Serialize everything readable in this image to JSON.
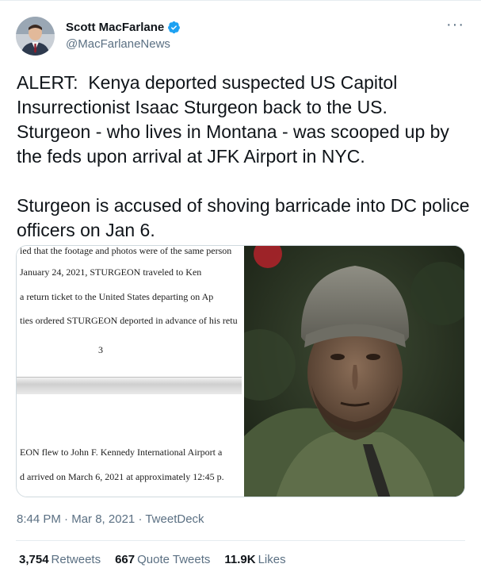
{
  "author": {
    "display_name": "Scott MacFarlane",
    "handle": "@MacFarlaneNews",
    "verified_icon": "verified-badge-icon"
  },
  "more_icon": "more-options-icon",
  "tweet": {
    "text": "ALERT:  Kenya deported suspected US Capitol Insurrectionist Isaac Sturgeon back to the US.  Sturgeon - who lives in Montana - was scooped up by the feds upon arrival at JFK Airport in NYC.\n\nSturgeon is accused of shoving barricade into DC police officers on Jan 6."
  },
  "media": {
    "document_lines": [
      "ied that the footage and photos were of the same person",
      "January  24,  2021,  STURGEON  traveled  to  Ken",
      "a  return  ticket  to  the United  States  departing  on  Ap",
      "ties ordered STURGEON deported in advance of his retu",
      "EON flew to John F. Kennedy International Airport a",
      "d arrived on March 6, 2021 at approximately 12:45 p."
    ],
    "document_page_number": "3"
  },
  "meta": {
    "time": "8:44 PM",
    "separator": "·",
    "date": "Mar 8, 2021",
    "source": "TweetDeck"
  },
  "stats": {
    "retweets_count": "3,754",
    "retweets_label": "Retweets",
    "quotes_count": "667",
    "quotes_label": "Quote Tweets",
    "likes_count": "11.9K",
    "likes_label": "Likes"
  },
  "colors": {
    "text": "#0f1419",
    "secondary": "#5b7083",
    "verified": "#1da1f2",
    "border": "#e6ecf0"
  }
}
